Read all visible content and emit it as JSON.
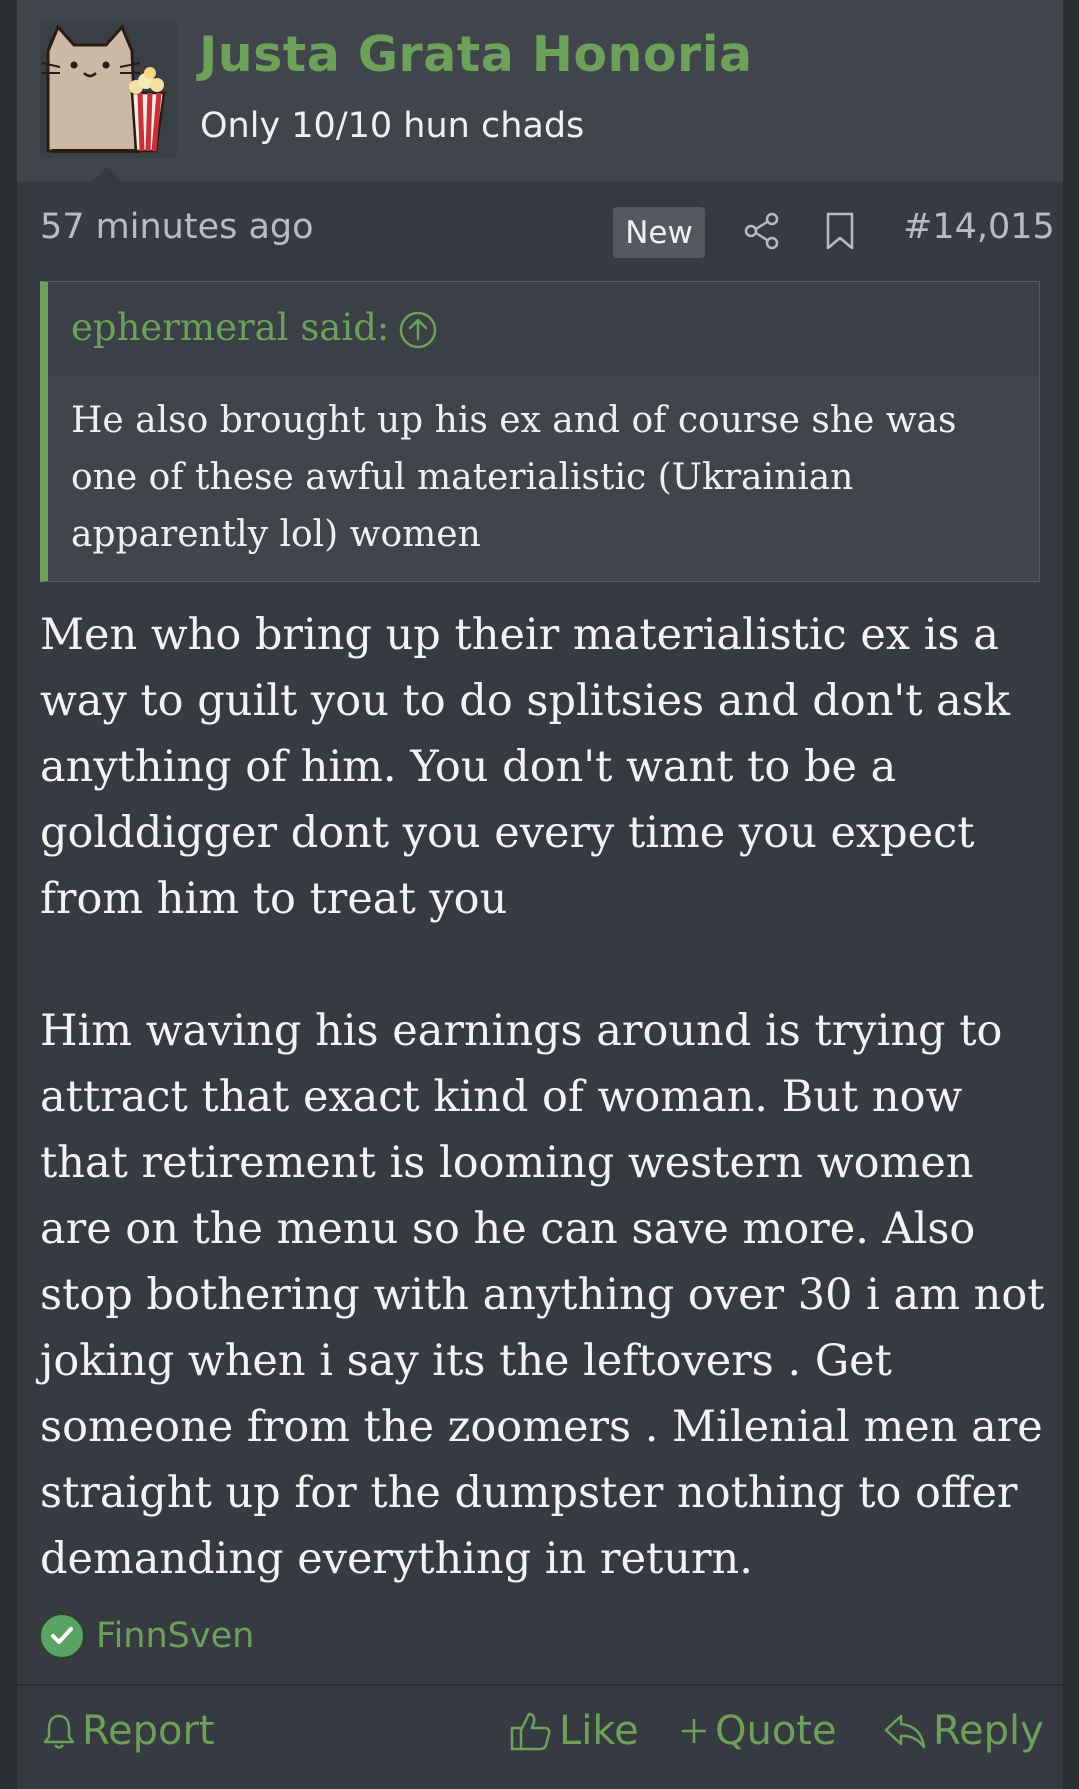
{
  "user": {
    "name": "Justa Grata Honoria",
    "title": "Only 10/10 hun chads"
  },
  "meta": {
    "time": "57 minutes ago",
    "badge": "New",
    "post_number": "#14,015"
  },
  "quote": {
    "author": "ephermeral said:",
    "text": "He also brought up his ex and of course she was one of these awful materialistic (Ukrainian apparently lol) women"
  },
  "message": {
    "paragraphs": [
      "Men who bring up their materialistic ex is a way to guilt you to do splitsies and don't ask anything of him. You don't want to be a golddigger dont you every time you expect from him to treat you",
      "Him waving his earnings around is trying to attract that exact kind of woman. But now that retirement is looming western women are on the menu so he can save more. Also stop bothering with anything over 30 i am not joking when i say its the leftovers . Get someone from the zoomers . Milenial men are straight up for the dumpster nothing to offer demanding everything in return."
    ]
  },
  "reaction": {
    "icon": "check-icon",
    "user": "FinnSven"
  },
  "actions": {
    "report": "Report",
    "like": "Like",
    "quote": "Quote",
    "reply": "Reply"
  },
  "colors": {
    "accent": "#6da05a",
    "background": "#373a41",
    "header": "#40444b"
  }
}
